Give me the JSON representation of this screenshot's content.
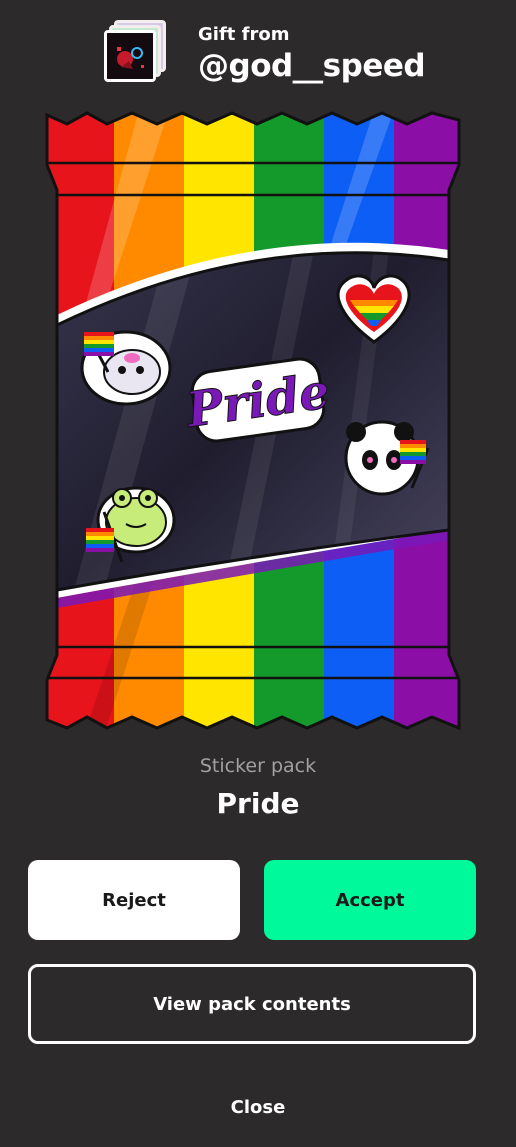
{
  "header": {
    "gift_from_label": "Gift from",
    "sender_handle": "@god__speed"
  },
  "pack": {
    "wrapper_stripe_colors": [
      "#e8141b",
      "#ff8a00",
      "#ffe500",
      "#139a2a",
      "#0d5ef5",
      "#8b0fa6"
    ],
    "logo_text": "Pride",
    "stickers": [
      "flag-ghost-sticker",
      "heart-sticker",
      "pride-logo-sticker",
      "panda-sticker",
      "frog-sticker"
    ]
  },
  "details": {
    "type_label": "Sticker pack",
    "name": "Pride"
  },
  "actions": {
    "reject_label": "Reject",
    "accept_label": "Accept",
    "view_contents_label": "View pack contents",
    "close_label": "Close"
  },
  "colors": {
    "background": "#2c2a2b",
    "accept": "#00f99b",
    "subtle_text": "#a3a0a1"
  }
}
